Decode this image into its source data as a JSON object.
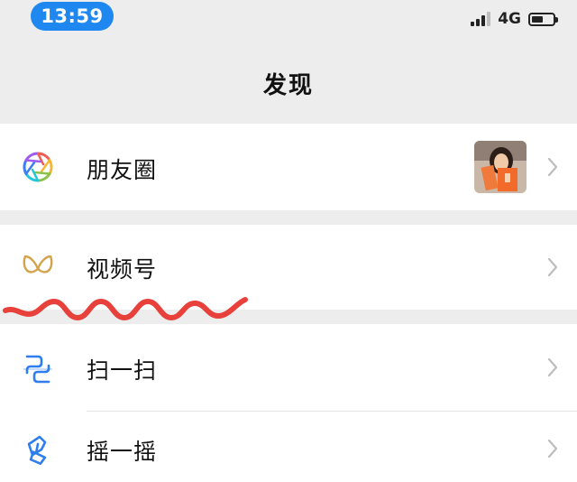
{
  "status_bar": {
    "time": "13:59",
    "network": "4G"
  },
  "nav": {
    "title": "发现"
  },
  "menu": {
    "items": [
      {
        "label": "朋友圈",
        "icon": "moments-icon"
      },
      {
        "label": "视频号",
        "icon": "channels-icon"
      },
      {
        "label": "扫一扫",
        "icon": "scan-icon"
      },
      {
        "label": "摇一摇",
        "icon": "shake-icon"
      }
    ]
  },
  "colors": {
    "page_bg": "#ededed",
    "cell_bg": "#ffffff",
    "time_pill": "#1e88f0",
    "accent_blue": "#2f7ef0",
    "channels_gold": "#d4a24a",
    "scribble_red": "#e8403a",
    "chevron": "#bdbdbd"
  }
}
